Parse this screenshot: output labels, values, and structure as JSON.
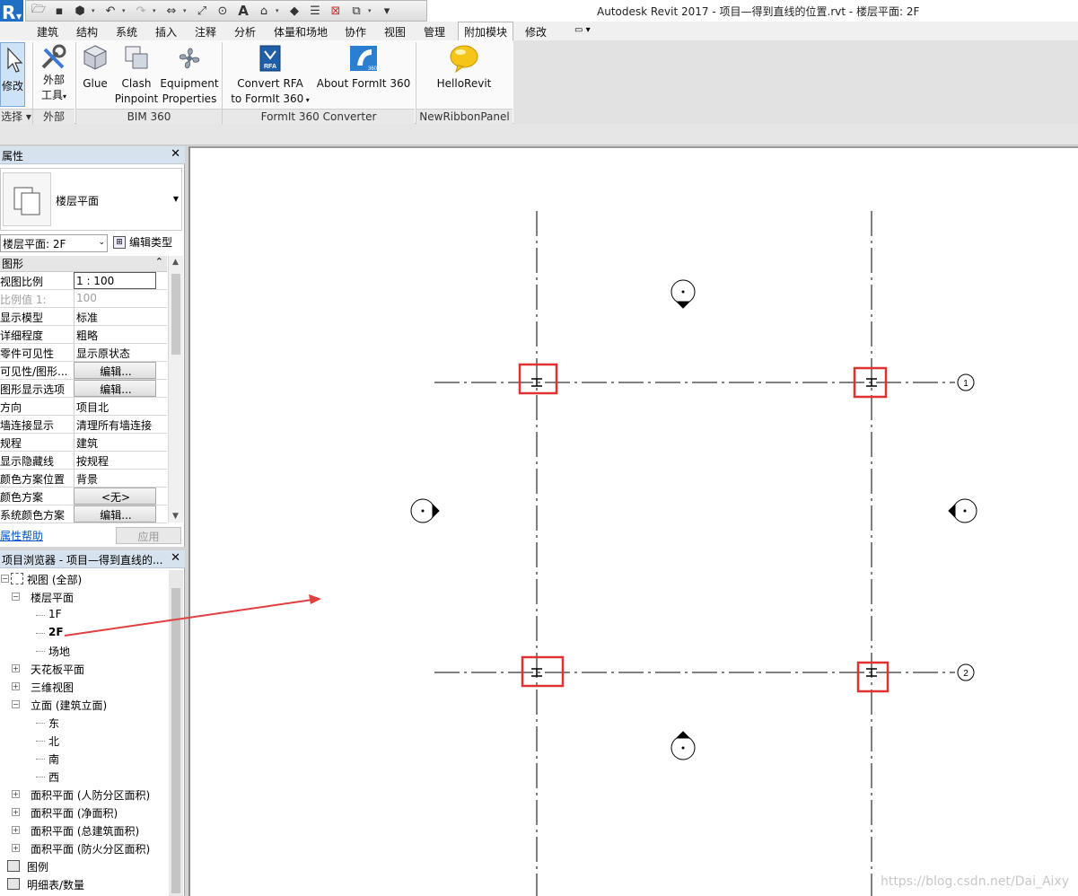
{
  "app": {
    "logo_letter": "R",
    "window_title": "Autodesk Revit 2017 -     项目—得到直线的位置.rvt - 楼层平面: 2F"
  },
  "tabs": [
    "建筑",
    "结构",
    "系统",
    "插入",
    "注释",
    "分析",
    "体量和场地",
    "协作",
    "视图",
    "管理",
    "附加模块",
    "修改"
  ],
  "active_tab": "附加模块",
  "ribbon": {
    "modify": {
      "label": "修改",
      "panel": "选择"
    },
    "external": {
      "label_line1": "外部",
      "label_line2": "工具",
      "panel": "外部"
    },
    "glue": {
      "label": "Glue"
    },
    "clash": {
      "line1": "Clash",
      "line2": "Pinpoint"
    },
    "equipment": {
      "line1": "Equipment",
      "line2": "Properties"
    },
    "bim360_panel": "BIM 360",
    "convert": {
      "line1": "Convert RFA",
      "line2": "to FormIt 360"
    },
    "about": {
      "label": "About FormIt 360"
    },
    "formit_panel": "FormIt 360 Converter",
    "hello": {
      "label": "HelloRevit"
    },
    "new_panel": "NewRibbonPanel"
  },
  "properties": {
    "title": "属性",
    "type_name": "楼层平面",
    "instance_selector": "楼层平面: 2F",
    "edit_type": "编辑类型",
    "group": "图形",
    "rows": [
      {
        "k": "视图比例",
        "v": "1 : 100",
        "kind": "input"
      },
      {
        "k": "比例值 1:",
        "v": "100",
        "kind": "dim"
      },
      {
        "k": "显示模型",
        "v": "标准",
        "kind": "text"
      },
      {
        "k": "详细程度",
        "v": "粗略",
        "kind": "text"
      },
      {
        "k": "零件可见性",
        "v": "显示原状态",
        "kind": "text"
      },
      {
        "k": "可见性/图形...",
        "v": "编辑...",
        "kind": "btn"
      },
      {
        "k": "图形显示选项",
        "v": "编辑...",
        "kind": "btn"
      },
      {
        "k": "方向",
        "v": "项目北",
        "kind": "text"
      },
      {
        "k": "墙连接显示",
        "v": "清理所有墙连接",
        "kind": "text"
      },
      {
        "k": "规程",
        "v": "建筑",
        "kind": "text"
      },
      {
        "k": "显示隐藏线",
        "v": "按规程",
        "kind": "text"
      },
      {
        "k": "颜色方案位置",
        "v": "背景",
        "kind": "text"
      },
      {
        "k": "颜色方案",
        "v": "<无>",
        "kind": "btn"
      },
      {
        "k": "系统颜色方案",
        "v": "编辑...",
        "kind": "btn"
      }
    ],
    "help_link": "属性帮助",
    "apply": "应用"
  },
  "browser": {
    "title": "项目浏览器 - 项目—得到直线的...",
    "nodes": [
      {
        "label": "视图 (全部)",
        "level": 0,
        "toggle": "-",
        "icon": "views"
      },
      {
        "label": "楼层平面",
        "level": 1,
        "toggle": "-"
      },
      {
        "label": "1F",
        "level": 2
      },
      {
        "label": "2F",
        "level": 2,
        "bold": true
      },
      {
        "label": "场地",
        "level": 2
      },
      {
        "label": "天花板平面",
        "level": 1,
        "toggle": "+"
      },
      {
        "label": "三维视图",
        "level": 1,
        "toggle": "+"
      },
      {
        "label": "立面 (建筑立面)",
        "level": 1,
        "toggle": "-"
      },
      {
        "label": "东",
        "level": 2
      },
      {
        "label": "北",
        "level": 2
      },
      {
        "label": "南",
        "level": 2
      },
      {
        "label": "西",
        "level": 2
      },
      {
        "label": "面积平面 (人防分区面积)",
        "level": 1,
        "toggle": "+"
      },
      {
        "label": "面积平面 (净面积)",
        "level": 1,
        "toggle": "+"
      },
      {
        "label": "面积平面 (总建筑面积)",
        "level": 1,
        "toggle": "+"
      },
      {
        "label": "面积平面 (防火分区面积)",
        "level": 1,
        "toggle": "+"
      },
      {
        "label": "图例",
        "level": 0,
        "icon": "legend"
      },
      {
        "label": "明细表/数量",
        "level": 0,
        "icon": "schedule"
      }
    ]
  },
  "canvas": {
    "grid_labels": [
      "1",
      "2"
    ],
    "watermark": "https://blog.csdn.net/Dai_Aixy"
  },
  "colors": {
    "accent": "#1f6fc5",
    "highlight": "#e03030",
    "arrow": "#e04040"
  }
}
